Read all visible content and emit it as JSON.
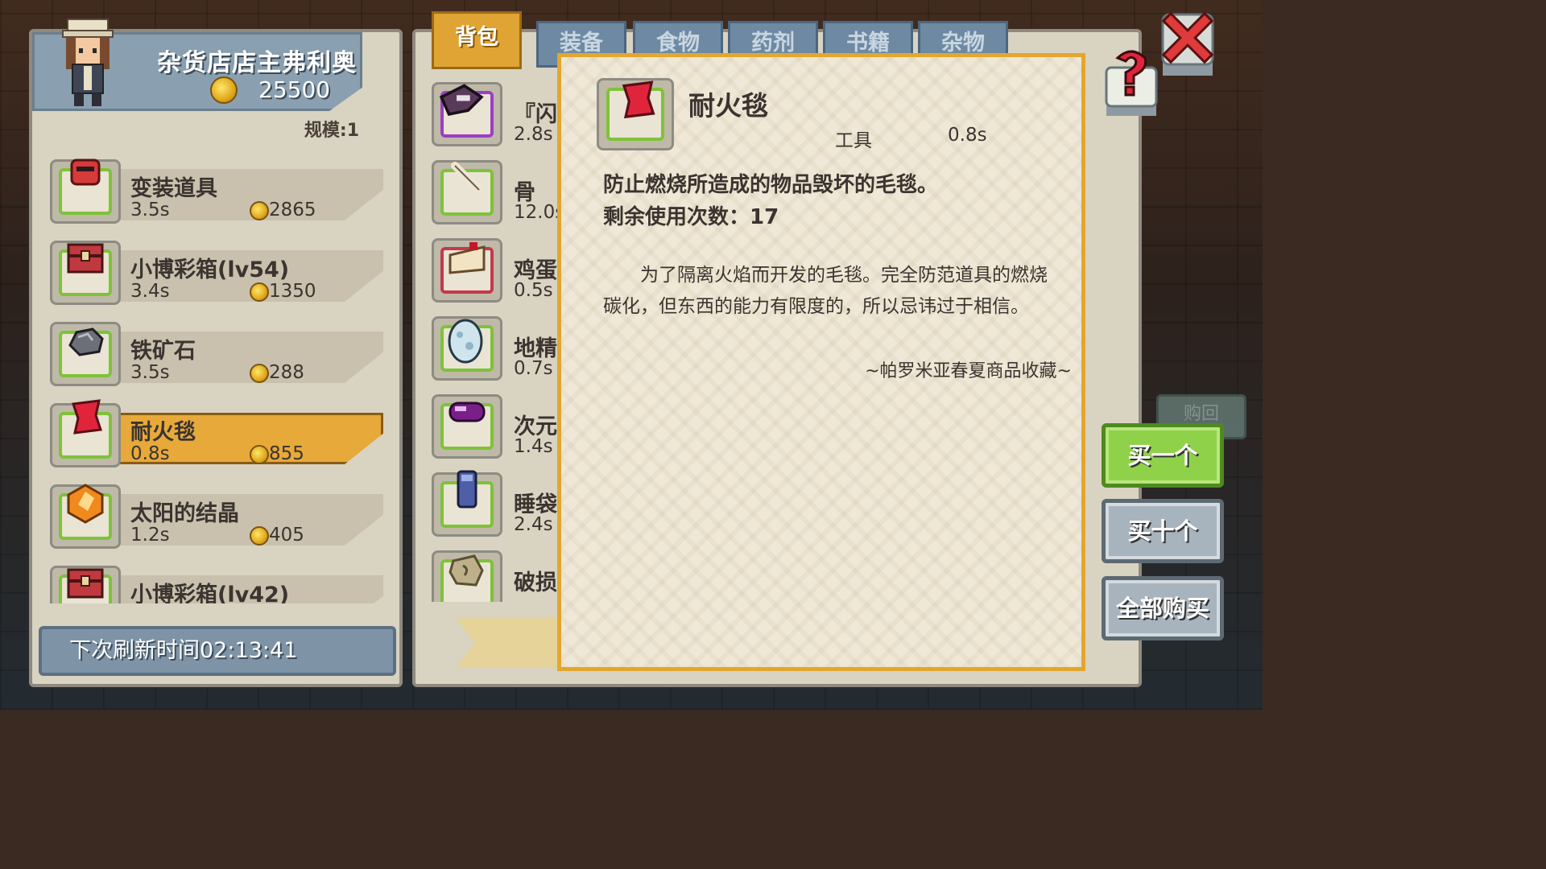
{
  "shop": {
    "owner_name": "杂货店店主弗利奥",
    "gold": "25500",
    "scale": "规模:1",
    "items": [
      {
        "name": "变装道具",
        "time": "3.5s",
        "price": "2865",
        "icon": "disguise-mask-icon",
        "color": "#d63a3a"
      },
      {
        "name": "小博彩箱(lv54)",
        "time": "3.4s",
        "price": "1350",
        "icon": "lottery-chest-icon",
        "color": "#c0393f"
      },
      {
        "name": "铁矿石",
        "time": "3.5s",
        "price": "288",
        "icon": "iron-ore-icon",
        "color": "#6d6f78"
      },
      {
        "name": "耐火毯",
        "time": "0.8s",
        "price": "855",
        "icon": "fireproof-blanket-icon",
        "color": "#e0253b",
        "selected": true
      },
      {
        "name": "太阳的结晶",
        "time": "1.2s",
        "price": "405",
        "icon": "sun-crystal-icon",
        "color": "#f08a1e"
      },
      {
        "name": "小博彩箱(lv42)",
        "time": "",
        "price": "",
        "icon": "lottery-chest-icon",
        "color": "#c0393f"
      }
    ],
    "refresh_label": "下次刷新时间02:13:41"
  },
  "inventory": {
    "tabs": [
      "背包",
      "装备",
      "食物",
      "药剂",
      "书籍",
      "杂物"
    ],
    "items": [
      {
        "name": "『闪",
        "time": "2.8s",
        "icon": "weapon-icon"
      },
      {
        "name": "骨",
        "time": "12.0s",
        "icon": "bone-icon"
      },
      {
        "name": "鸡蛋",
        "time": "0.5s",
        "icon": "cake-icon"
      },
      {
        "name": "地精",
        "time": "0.7s",
        "icon": "egg-icon"
      },
      {
        "name": "次元",
        "time": "1.4s",
        "icon": "pill-icon"
      },
      {
        "name": "睡袋",
        "time": "2.4s",
        "icon": "sleeping-bag-icon"
      },
      {
        "name": "破损",
        "time": "",
        "icon": "broken-stone-icon"
      }
    ]
  },
  "detail": {
    "name": "耐火毯",
    "category": "工具",
    "time": "0.8s",
    "desc1": "防止燃烧所造成的物品毁坏的毛毯。",
    "desc2": "剩余使用次数：17",
    "flavor": "为了隔离火焰而开发的毛毯。完全防范道具的燃烧碳化，但东西的能力有限度的，所以忌讳过于相信。",
    "source": "~帕罗米亚春夏商品收藏~"
  },
  "buttons": {
    "buy_one": "买一个",
    "buy_ten": "买十个",
    "buy_all": "全部购买",
    "background_hint": "购回"
  },
  "colors": {
    "accent_gold": "#e3a62e",
    "buy_green": "#8fd24a",
    "close_red": "#e03a3a"
  }
}
